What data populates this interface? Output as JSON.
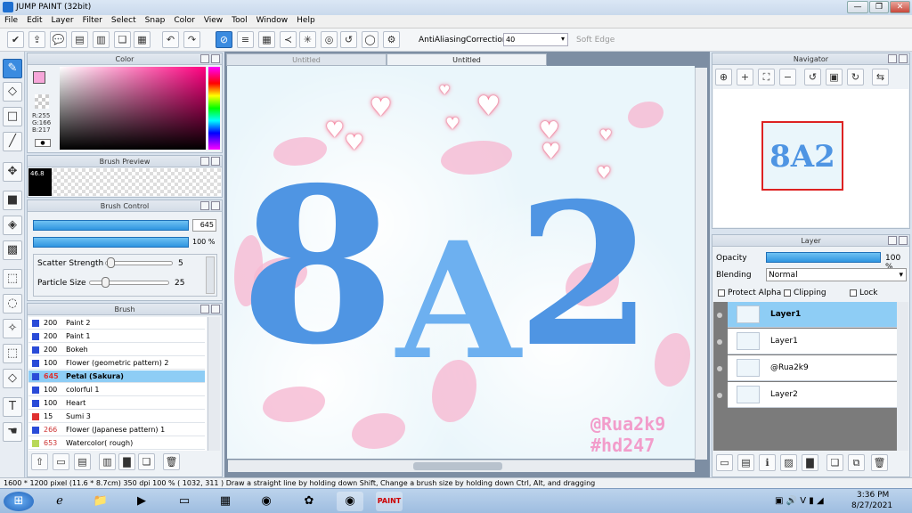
{
  "window": {
    "title": "JUMP PAINT (32bit)"
  },
  "menu": [
    "File",
    "Edit",
    "Layer",
    "Filter",
    "Select",
    "Snap",
    "Color",
    "View",
    "Tool",
    "Window",
    "Help"
  ],
  "toolbar": {
    "antialias_label": "AntiAliasing",
    "correction_label": "Correction",
    "correction_value": "40",
    "soft_edge_label": "Soft Edge"
  },
  "color_panel": {
    "title": "Color",
    "r": "R:255",
    "g": "G:166",
    "b": "B:217",
    "primary": "#f6a6d9"
  },
  "brush_preview": {
    "title": "Brush Preview",
    "size": "46.8"
  },
  "brush_control": {
    "title": "Brush Control",
    "size_value": "645",
    "opacity_value": "100 %",
    "scatter_label": "Scatter Strength",
    "scatter_value": "5",
    "particle_label": "Particle Size",
    "particle_value": "25"
  },
  "brush_list": {
    "title": "Brush",
    "items": [
      {
        "size": "200",
        "name": "Paint 2",
        "color": "#2a4bd8"
      },
      {
        "size": "200",
        "name": "Paint 1",
        "color": "#2a4bd8"
      },
      {
        "size": "200",
        "name": "Bokeh",
        "color": "#2a4bd8"
      },
      {
        "size": "100",
        "name": "Flower (geometric pattern) 2",
        "color": "#2a4bd8"
      },
      {
        "size": "645",
        "name": "Petal (Sakura)",
        "color": "#2a4bd8",
        "selected": true
      },
      {
        "size": "100",
        "name": "colorful 1",
        "color": "#2a4bd8"
      },
      {
        "size": "100",
        "name": "Heart",
        "color": "#2a4bd8"
      },
      {
        "size": "15",
        "name": "Sumi 3",
        "color": "#e03030"
      },
      {
        "size": "266",
        "name": "Flower (Japanese pattern) 1",
        "color": "#2a4bd8"
      },
      {
        "size": "653",
        "name": "Watercolor( rough)",
        "color": "#b8d858"
      }
    ]
  },
  "tabs": [
    "Untitled",
    "Untitled"
  ],
  "artwork": {
    "main_text_1": "8",
    "main_text_2": "A",
    "main_text_3": "2",
    "credit_1": "@Rua2k9",
    "credit_2": "#hd247"
  },
  "navigator": {
    "title": "Navigator",
    "thumb_text": "8A2"
  },
  "layer_panel": {
    "title": "Layer",
    "opacity_label": "Opacity",
    "opacity_value": "100 %",
    "blending_label": "Blending",
    "blending_value": "Normal",
    "protect_alpha": "Protect Alpha",
    "clipping": "Clipping",
    "lock": "Lock",
    "layers": [
      {
        "name": "Layer1",
        "active": true
      },
      {
        "name": "Layer1"
      },
      {
        "name": "@Rua2k9"
      },
      {
        "name": "Layer2"
      }
    ]
  },
  "status": {
    "text": "1600 * 1200 pixel   (11.6 * 8.7cm)   350 dpi   100 %   ( 1032, 311 )   Draw a straight line by holding down Shift, Change a brush size by holding down Ctrl, Alt, and dragging"
  },
  "taskbar": {
    "time": "3:36 PM",
    "date": "8/27/2021"
  }
}
